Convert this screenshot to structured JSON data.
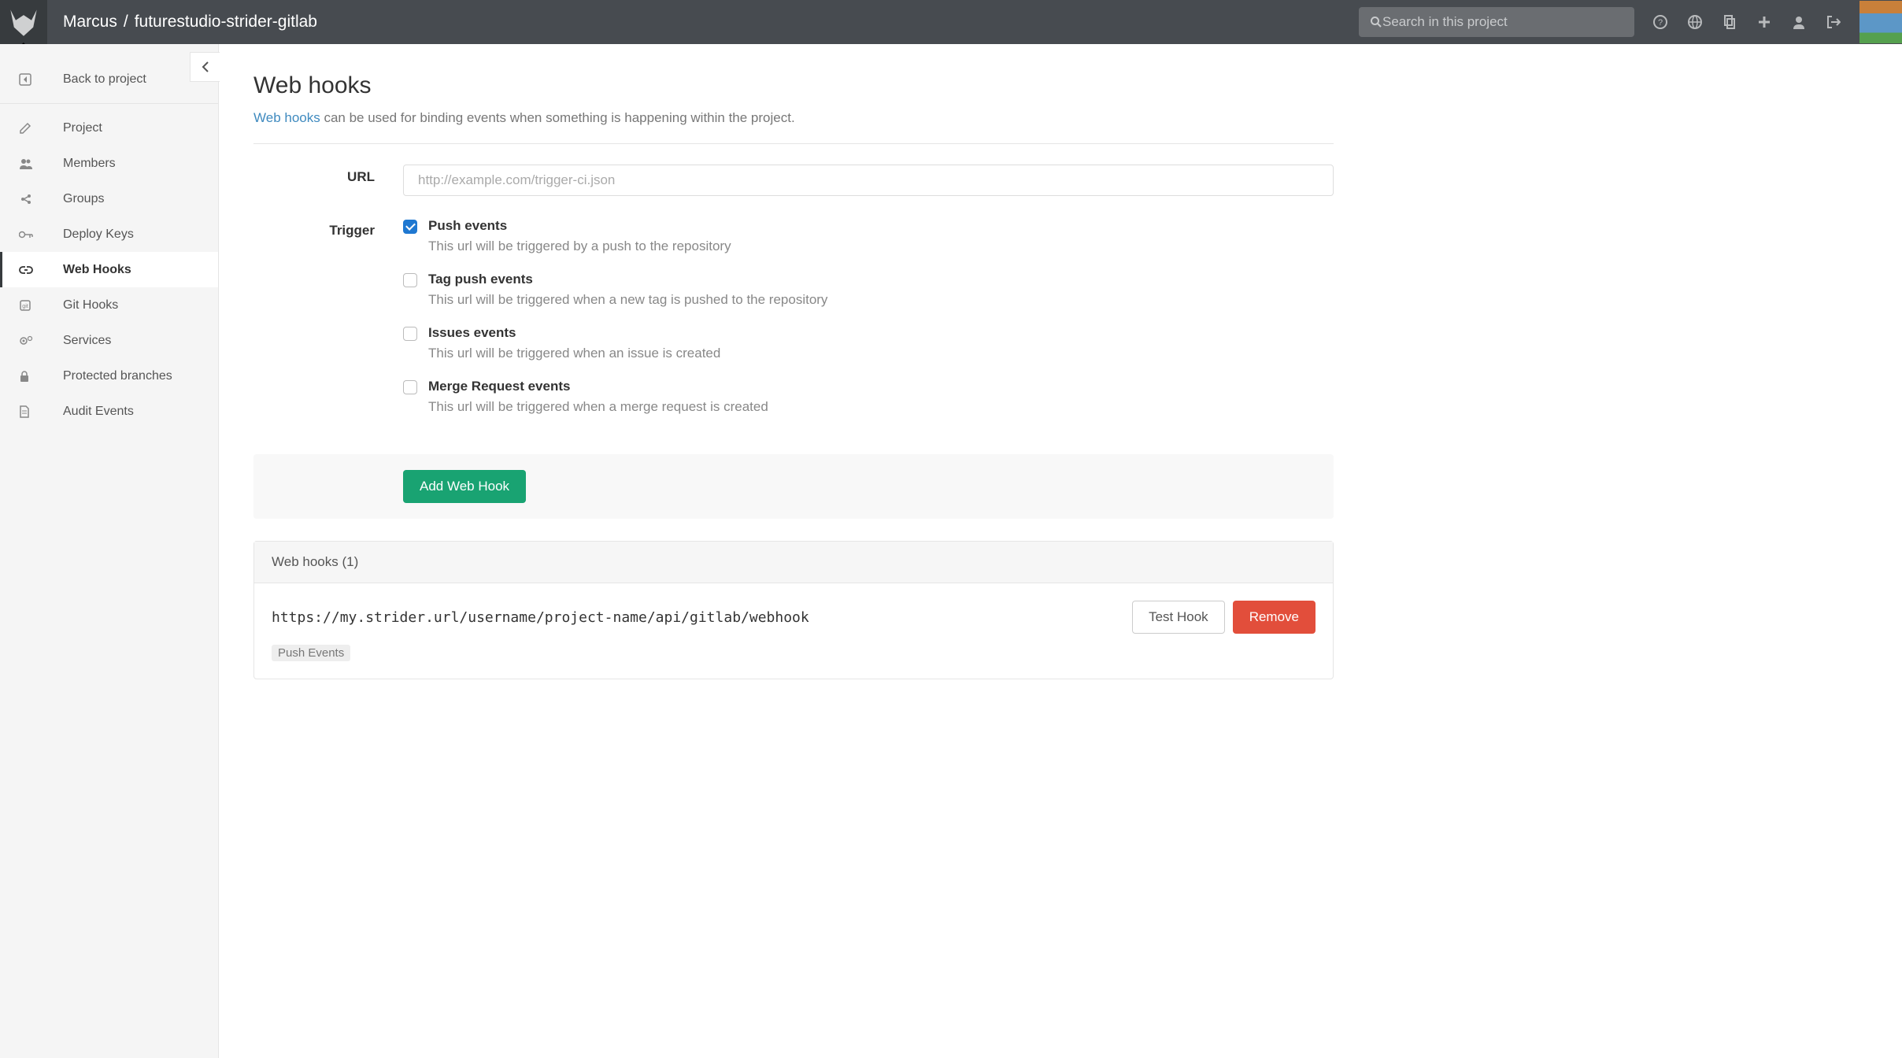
{
  "header": {
    "tooltip": "Dashboard",
    "breadcrumb_user": "Marcus",
    "breadcrumb_sep": "/",
    "breadcrumb_project": "futurestudio-strider-gitlab",
    "search_placeholder": "Search in this project"
  },
  "sidebar": {
    "back_label": "Back to project",
    "items": [
      {
        "label": "Project"
      },
      {
        "label": "Members"
      },
      {
        "label": "Groups"
      },
      {
        "label": "Deploy Keys"
      },
      {
        "label": "Web Hooks"
      },
      {
        "label": "Git Hooks"
      },
      {
        "label": "Services"
      },
      {
        "label": "Protected branches"
      },
      {
        "label": "Audit Events"
      }
    ]
  },
  "page": {
    "title": "Web hooks",
    "subtitle_link": "Web hooks",
    "subtitle_rest": " can be used for binding events when something is happening within the project."
  },
  "form": {
    "url_label": "URL",
    "url_placeholder": "http://example.com/trigger-ci.json",
    "trigger_label": "Trigger",
    "triggers": [
      {
        "name": "Push events",
        "desc": "This url will be triggered by a push to the repository",
        "checked": true
      },
      {
        "name": "Tag push events",
        "desc": "This url will be triggered when a new tag is pushed to the repository",
        "checked": false
      },
      {
        "name": "Issues events",
        "desc": "This url will be triggered when an issue is created",
        "checked": false
      },
      {
        "name": "Merge Request events",
        "desc": "This url will be triggered when a merge request is created",
        "checked": false
      }
    ],
    "submit_label": "Add Web Hook"
  },
  "hooks": {
    "heading": "Web hooks (1)",
    "items": [
      {
        "url": "https://my.strider.url/username/project-name/api/gitlab/webhook",
        "badge": "Push Events",
        "test": "Test Hook",
        "remove": "Remove"
      }
    ]
  }
}
